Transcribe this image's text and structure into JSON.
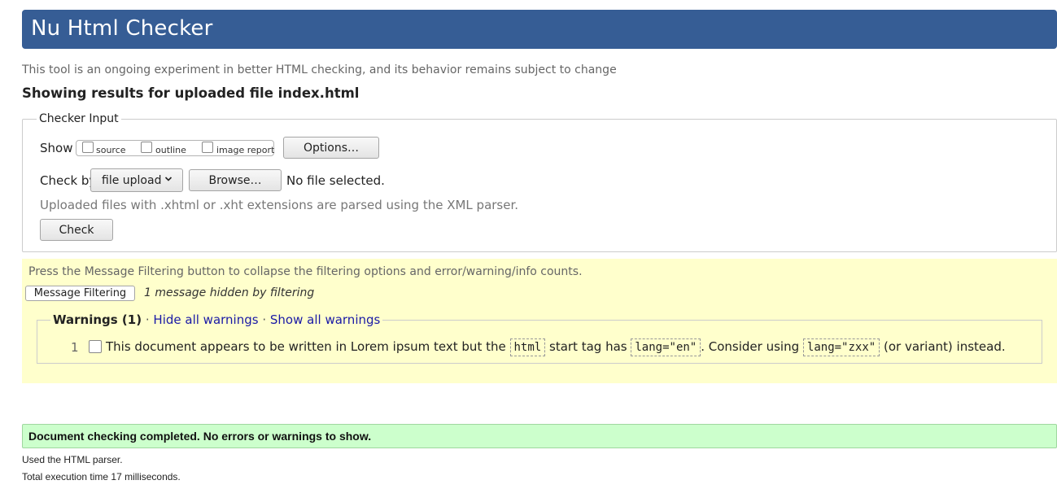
{
  "header": {
    "title": "Nu Html Checker"
  },
  "subtitle": "This tool is an ongoing experiment in better HTML checking, and its behavior remains subject to change",
  "results_heading": "Showing results for uploaded file index.html",
  "checker_input": {
    "legend": "Checker Input",
    "show_label": "Show",
    "show_options": [
      {
        "label": "source",
        "checked": false
      },
      {
        "label": "outline",
        "checked": false
      },
      {
        "label": "image report",
        "checked": false
      }
    ],
    "options_button": "Options…",
    "check_by_label": "Check by",
    "check_by_value": "file upload",
    "browse_button": "Browse…",
    "file_status": "No file selected.",
    "parser_note": "Uploaded files with .xhtml or .xht extensions are parsed using the XML parser.",
    "check_button": "Check"
  },
  "filtering": {
    "instructions": "Press the Message Filtering button to collapse the filtering options and error/warning/info counts.",
    "button_label": "Message Filtering",
    "hidden_message": "1 message hidden by filtering",
    "warnings_title": "Warnings (1)",
    "separator": "·",
    "hide_all": "Hide all warnings",
    "show_all": "Show all warnings",
    "messages": [
      {
        "number": "1",
        "text_1": "This document appears to be written in Lorem ipsum text but the",
        "code_1": "html",
        "text_2": "start tag has",
        "code_2": "lang=\"en\"",
        "text_3": ". Consider using",
        "code_3": "lang=\"zxx\"",
        "text_4": "(or variant) instead."
      }
    ]
  },
  "status": {
    "message": "Document checking completed. No errors or warnings to show."
  },
  "footer": {
    "parser": "Used the HTML parser.",
    "time": "Total execution time 17 milliseconds."
  },
  "colors": {
    "header_bg": "#365d95",
    "filter_bg": "#ffffcc",
    "status_bg": "#ccffcc",
    "link": "#1a1aa6"
  }
}
